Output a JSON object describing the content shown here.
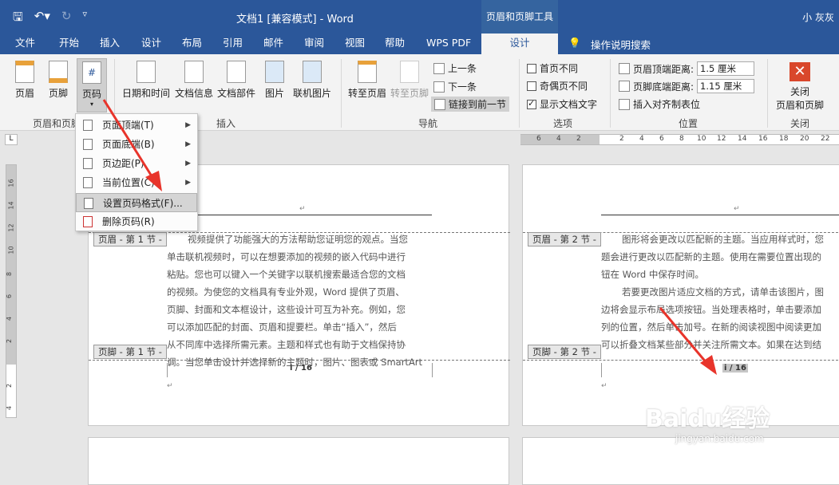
{
  "titlebar": {
    "doc_title": "文档1 [兼容模式] - Word",
    "context_tool": "页眉和页脚工具",
    "user": "小 灰灰"
  },
  "qat": {
    "save_icon": "save-icon",
    "undo_icon": "undo-icon",
    "redo_icon": "redo-icon",
    "customize_icon": "customize-icon"
  },
  "tabs": [
    "文件",
    "开始",
    "插入",
    "设计",
    "布局",
    "引用",
    "邮件",
    "审阅",
    "视图",
    "帮助",
    "WPS PDF",
    "设计"
  ],
  "tell_me": "操作说明搜索",
  "ribbon": {
    "group1": {
      "header": "页眉",
      "footer": "页脚",
      "page_number": "页码",
      "label": "页眉和页脚"
    },
    "insert": {
      "datetime": "日期和时间",
      "docinfo": "文档信息",
      "quickparts": "文档部件",
      "picture": "图片",
      "online_picture": "联机图片",
      "label": "插入"
    },
    "nav": {
      "goto_header": "转至页眉",
      "goto_footer": "转至页脚",
      "prev": "上一条",
      "next": "下一条",
      "link_prev": "链接到前一节",
      "label": "导航"
    },
    "options": {
      "diff_first": "首页不同",
      "diff_odd_even": "奇偶页不同",
      "show_text": "显示文档文字",
      "label": "选项"
    },
    "position": {
      "header_top": "页眉顶端距离:",
      "header_top_val": "1.5 厘米",
      "footer_bottom": "页脚底端距离:",
      "footer_bottom_val": "1.15 厘米",
      "align_tab": "插入对齐制表位",
      "label": "位置"
    },
    "close": {
      "line1": "关闭",
      "line2": "页眉和页脚",
      "label": "关闭"
    }
  },
  "ruler_top": [
    "6",
    "4",
    "2",
    "2",
    "4",
    "6",
    "8",
    "10",
    "12",
    "14",
    "16",
    "18",
    "20",
    "22"
  ],
  "ruler_left": [
    "16",
    "14",
    "12",
    "10",
    "8",
    "6",
    "4",
    "2",
    "2",
    "4"
  ],
  "page_number_menu": {
    "items": [
      {
        "label": "页面顶端(T)"
      },
      {
        "label": "页面底端(B)"
      },
      {
        "label": "页边距(P)"
      },
      {
        "label": "当前位置(C)"
      },
      {
        "label": "设置页码格式(F)..."
      },
      {
        "label": "删除页码(R)"
      }
    ]
  },
  "page1": {
    "header_tag": "页眉 - 第 1 节 -",
    "footer_tag": "页脚 - 第 1 节 -",
    "lines": [
      "视频提供了功能强大的方法帮助您证明您的观点。当您",
      "单击联机视频时，可以在想要添加的视频的嵌入代码中进行",
      "粘贴。您也可以键入一个关键字以联机搜索最适合您的文档",
      "的视频。为使您的文档具有专业外观，Word 提供了页眉、",
      "页脚、封面和文本框设计，这些设计可互为补充。例如，您",
      "可以添加匹配的封面、页眉和提要栏。单击“插入”，然后",
      "从不同库中选择所需元素。主题和样式也有助于文档保持协",
      "调。当您单击设计并选择新的主题时，图片、图表或 SmartArt"
    ],
    "page_number": "i / 16"
  },
  "page2": {
    "header_tag": "页眉 - 第 2 节 -",
    "footer_tag": "页脚 - 第 2 节 -",
    "lines": [
      "图形将会更改以匹配新的主题。当应用样式时，您",
      "题会进行更改以匹配新的主题。使用在需要位置出现的",
      "钮在 Word 中保存时间。",
      "若要更改图片适应文档的方式，请单击该图片，图",
      "边将会显示布局选项按钮。当处理表格时，单击要添加",
      "列的位置，然后单击加号。在新的阅读视图中阅读更加",
      "可以折叠文档某些部分并关注所需文本。如果在达到结"
    ],
    "page_number": "i / 16"
  },
  "watermark": {
    "text": "Baidu经验",
    "sub": "jingyan.baidu.com"
  },
  "colors": {
    "title_bar": "#2b579a",
    "arrow": "#e8342b"
  }
}
